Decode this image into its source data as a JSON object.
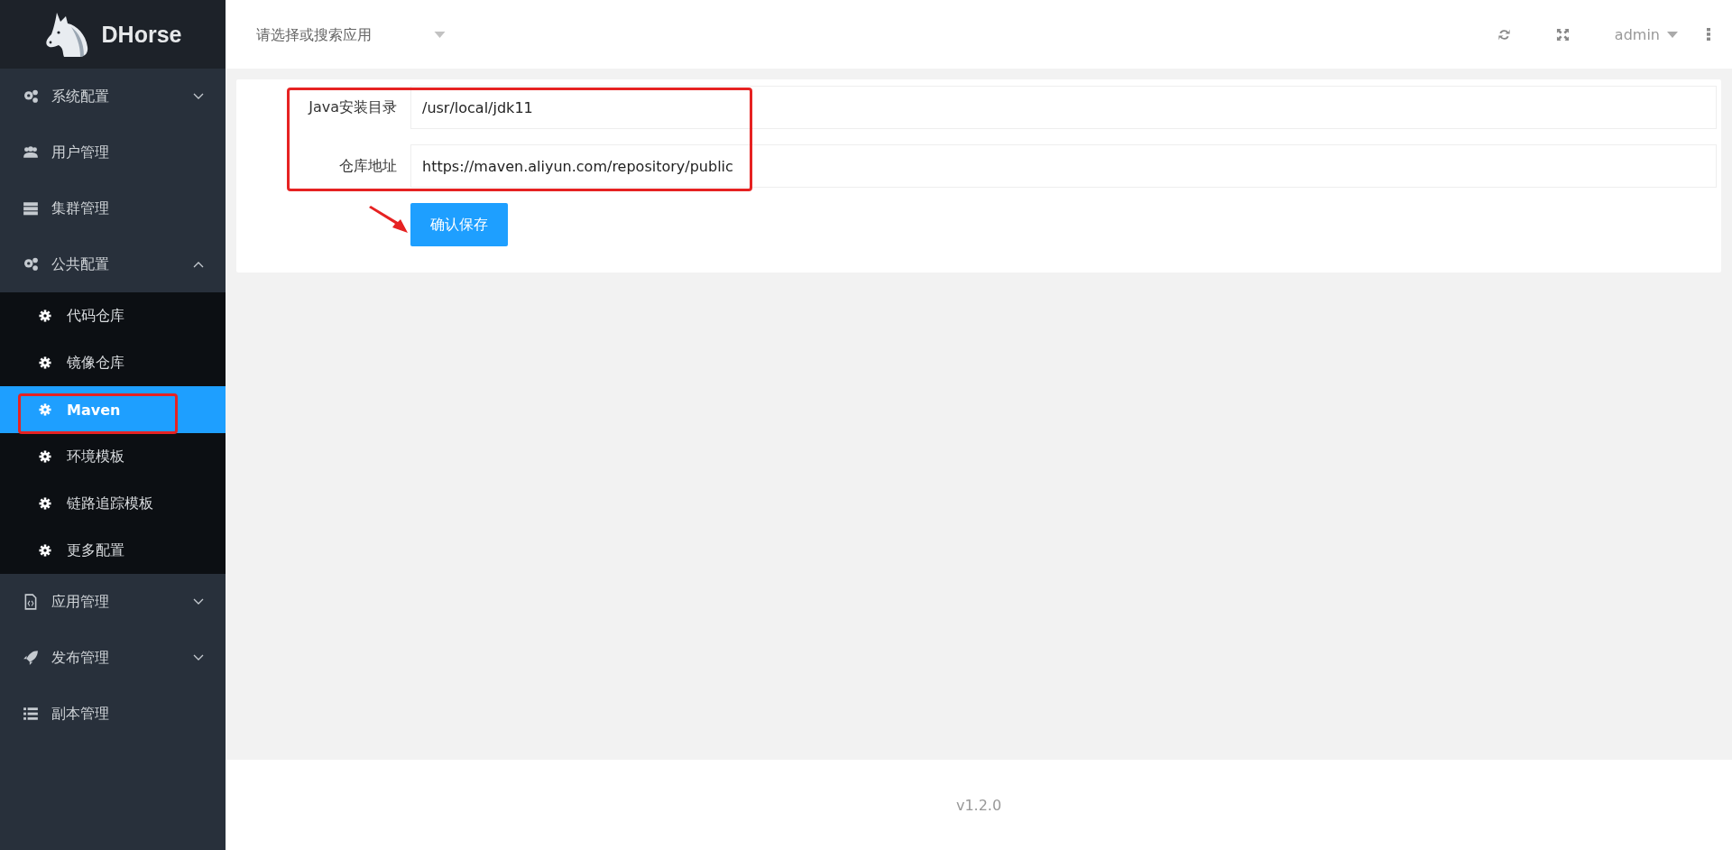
{
  "sidebar": {
    "logo_text": "DHorse",
    "items": [
      {
        "label": "系统配置",
        "selected": false,
        "expanded": false
      },
      {
        "label": "用户管理",
        "selected": false
      },
      {
        "label": "集群管理",
        "selected": false
      },
      {
        "label": "公共配置",
        "selected": false,
        "expanded": true,
        "children": [
          {
            "label": "代码仓库",
            "selected": false
          },
          {
            "label": "镜像仓库",
            "selected": false
          },
          {
            "label": "Maven",
            "selected": true
          },
          {
            "label": "环境模板",
            "selected": false
          },
          {
            "label": "链路追踪模板",
            "selected": false
          },
          {
            "label": "更多配置",
            "selected": false
          }
        ]
      },
      {
        "label": "应用管理",
        "selected": false,
        "expanded": false
      },
      {
        "label": "发布管理",
        "selected": false,
        "expanded": false
      },
      {
        "label": "副本管理",
        "selected": false
      }
    ]
  },
  "header": {
    "app_select": {
      "placeholder": "请选择或搜索应用"
    },
    "user": "admin"
  },
  "form": {
    "fields": [
      {
        "label": "Java安装目录",
        "value": "/usr/local/jdk11"
      },
      {
        "label": "仓库地址",
        "value": "https://maven.aliyun.com/repository/public"
      }
    ],
    "save_button": "确认保存"
  },
  "footer": {
    "version": "v1.2.0"
  }
}
